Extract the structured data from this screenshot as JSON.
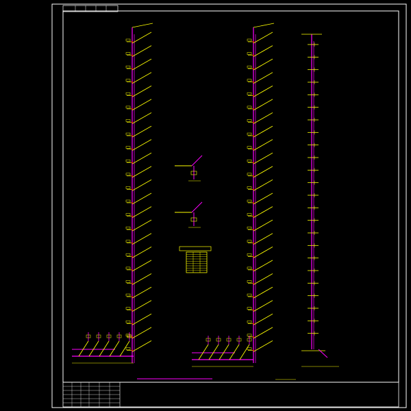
{
  "drawing": {
    "title_block_top": "",
    "main_caption": "",
    "note": "",
    "colors": {
      "background": "#000000",
      "frame": "#ffffff",
      "pipe_main": "#ff00ff",
      "pipe_branch": "#ffff00",
      "text": "#ffff00",
      "accent": "#ff0000"
    },
    "risers": [
      {
        "id": "left",
        "floors": 24
      },
      {
        "id": "middle",
        "floors": 24
      },
      {
        "id": "right",
        "floors": 24
      }
    ],
    "legend_table_rows": 9
  }
}
